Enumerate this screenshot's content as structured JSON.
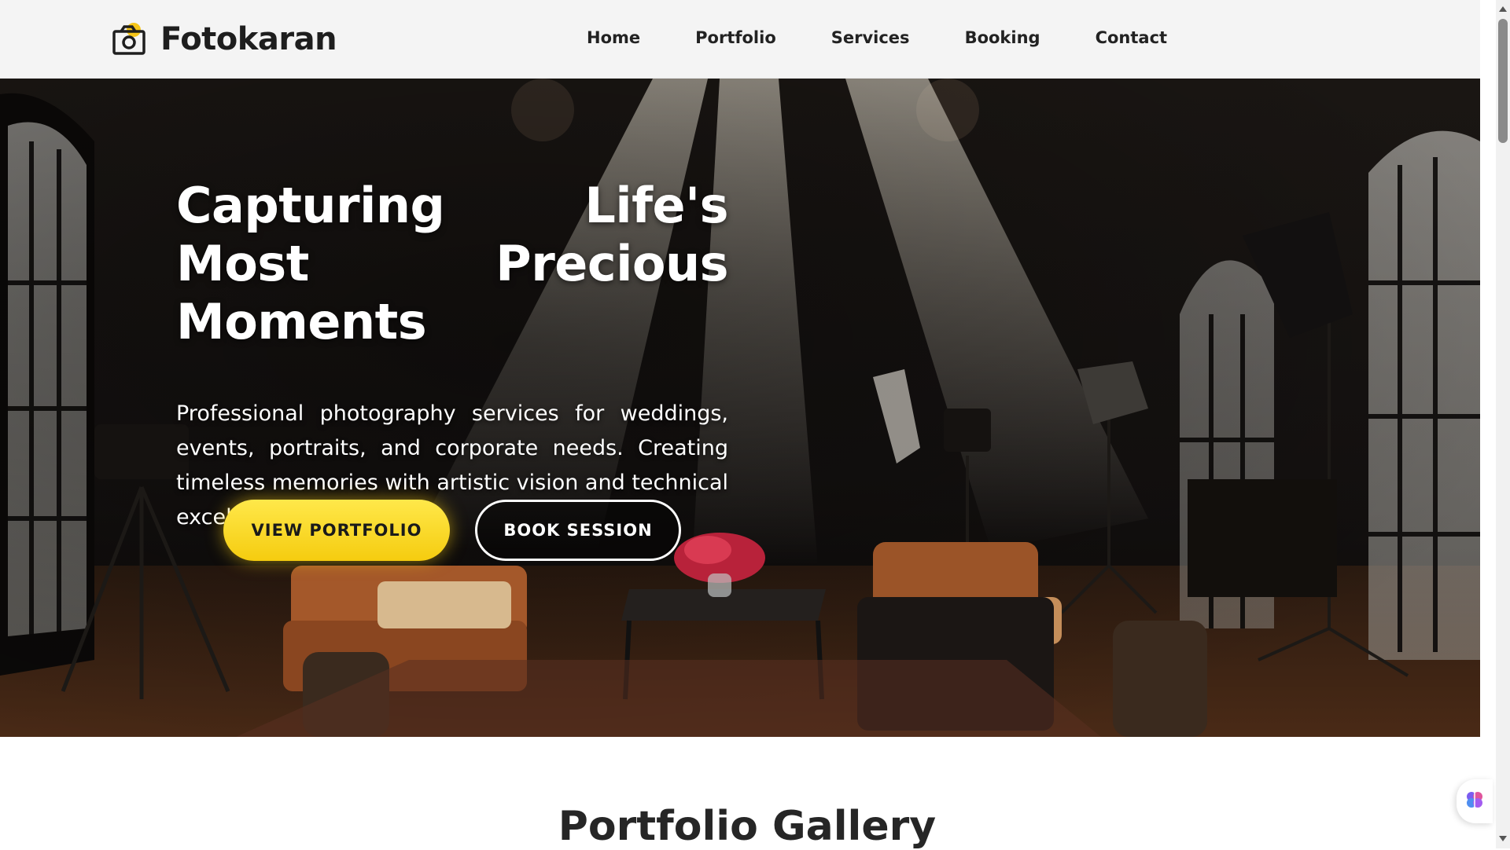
{
  "brand": {
    "name": "Fotokaran",
    "logo_icon": "camera-icon",
    "accent": "#f5c518"
  },
  "nav": {
    "items": [
      {
        "label": "Home"
      },
      {
        "label": "Portfolio"
      },
      {
        "label": "Services"
      },
      {
        "label": "Booking"
      },
      {
        "label": "Contact"
      }
    ]
  },
  "hero": {
    "title": "Capturing Life's Most Precious Moments",
    "description": "Professional photography services for weddings, events, portraits, and corporate needs. Creating timeless memories with artistic vision and technical excellence.",
    "primary_button": "VIEW PORTFOLIO",
    "secondary_button": "BOOK SESSION",
    "primary_color": "#f5cc0f"
  },
  "portfolio": {
    "title": "Portfolio Gallery"
  },
  "floating_widget": {
    "icon": "brain-icon"
  }
}
